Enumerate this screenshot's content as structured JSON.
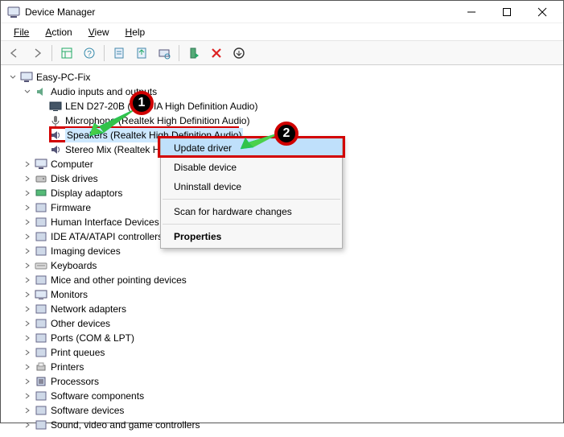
{
  "window": {
    "title": "Device Manager"
  },
  "menu": {
    "file": "File",
    "action": "Action",
    "view": "View",
    "help": "Help"
  },
  "tree": {
    "root": "Easy-PC-Fix",
    "audio_group": "Audio inputs and outputs",
    "audio_items": [
      "LEN D27-20B (NVIDIA High Definition Audio)",
      "Microphone (Realtek High Definition Audio)",
      "Speakers (Realtek High Definition Audio)",
      "Stereo Mix (Realtek High Definition Audio)"
    ],
    "categories": [
      "Computer",
      "Disk drives",
      "Display adaptors",
      "Firmware",
      "Human Interface Devices",
      "IDE ATA/ATAPI controllers",
      "Imaging devices",
      "Keyboards",
      "Mice and other pointing devices",
      "Monitors",
      "Network adapters",
      "Other devices",
      "Ports (COM & LPT)",
      "Print queues",
      "Printers",
      "Processors",
      "Software components",
      "Software devices",
      "Sound, video and game controllers"
    ]
  },
  "context_menu": {
    "update": "Update driver",
    "disable": "Disable device",
    "uninstall": "Uninstall device",
    "scan": "Scan for hardware changes",
    "properties": "Properties"
  },
  "annotations": {
    "badge1": "1",
    "badge2": "2"
  }
}
